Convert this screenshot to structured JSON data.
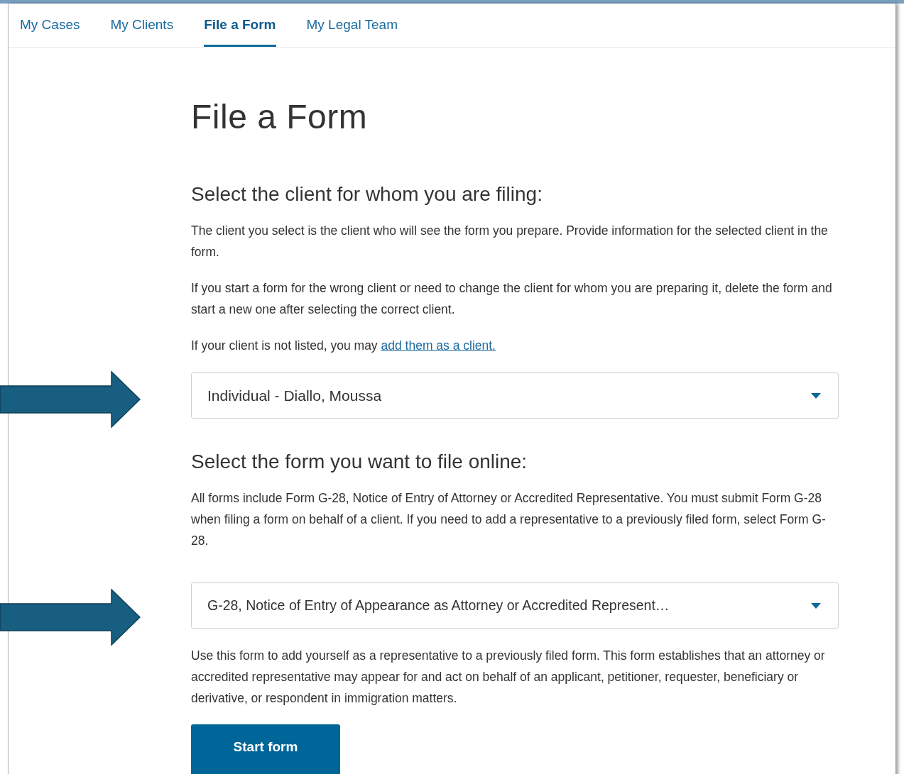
{
  "tabs": [
    {
      "label": "My Cases",
      "selected": false
    },
    {
      "label": "My Clients",
      "selected": false
    },
    {
      "label": "File a Form",
      "selected": true
    },
    {
      "label": "My Legal Team",
      "selected": false
    }
  ],
  "title": "File a Form",
  "client_section": {
    "heading": "Select the client for whom you are filing:",
    "paragraphs": [
      "The client you select is the client who will see the form you prepare. Provide information for the selected client in the form.",
      "If you start a form for the wrong client or need to change the client for whom you are preparing it, delete the form and start a new one after selecting the correct client."
    ],
    "note": {
      "text": "If your client is not listed, you may",
      "link": "add them as a client."
    },
    "dropdown": {
      "value": "Individual - Diallo, Moussa"
    }
  },
  "form_section": {
    "heading": "Select the form you want to file online:",
    "paragraphs": [
      "All forms include Form G-28, Notice of Entry of Attorney or Accredited Representative. You must submit Form G-28 when filing a form on behalf of a client. If you need to add a representative to a previously filed form, select Form G-28."
    ],
    "dropdown": {
      "value": "G-28, Notice of Entry of Appearance as Attorney or Accredited Represent…"
    },
    "description": "Use this form to add yourself as a representative to a previously filed form. This form establishes that an attorney or accredited representative may appear for and act on behalf of an applicant, petitioner, requester, beneficiary or derivative, or respondent in immigration matters."
  },
  "button": "Start form"
}
